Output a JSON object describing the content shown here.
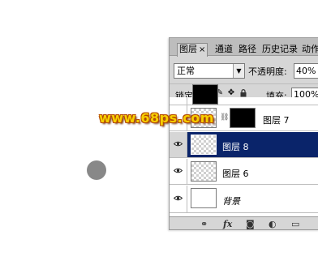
{
  "panel": {
    "tabs": [
      {
        "label": "图层",
        "close": "×",
        "active": true
      },
      {
        "label": "通道"
      },
      {
        "label": "路径"
      },
      {
        "label": "历史记录"
      },
      {
        "label": "动作"
      }
    ],
    "blend_mode": "正常",
    "opacity_label": "不透明度:",
    "opacity_value": "40%",
    "lock_label": "锁定:",
    "fill_label": "填充:",
    "fill_value": "100%"
  },
  "layers": [
    {
      "name": "图层 7",
      "thumb": "black",
      "mask": true,
      "visible": false,
      "selected": false
    },
    {
      "name": "图层 8",
      "thumb": "transparent",
      "visible": true,
      "selected": true
    },
    {
      "name": "图层 6",
      "thumb": "transparent",
      "visible": true,
      "selected": false
    },
    {
      "name": "背景",
      "thumb": "white",
      "visible": true,
      "selected": false,
      "italic": true
    }
  ],
  "bottom_icons": [
    "link-layers-icon",
    "layer-style-icon",
    "add-mask-icon",
    "adjustment-layer-icon",
    "new-group-icon"
  ],
  "watermark": "www.68ps.com",
  "colors": {
    "selected_row": "#0a246a",
    "watermark": "#f6d000"
  }
}
